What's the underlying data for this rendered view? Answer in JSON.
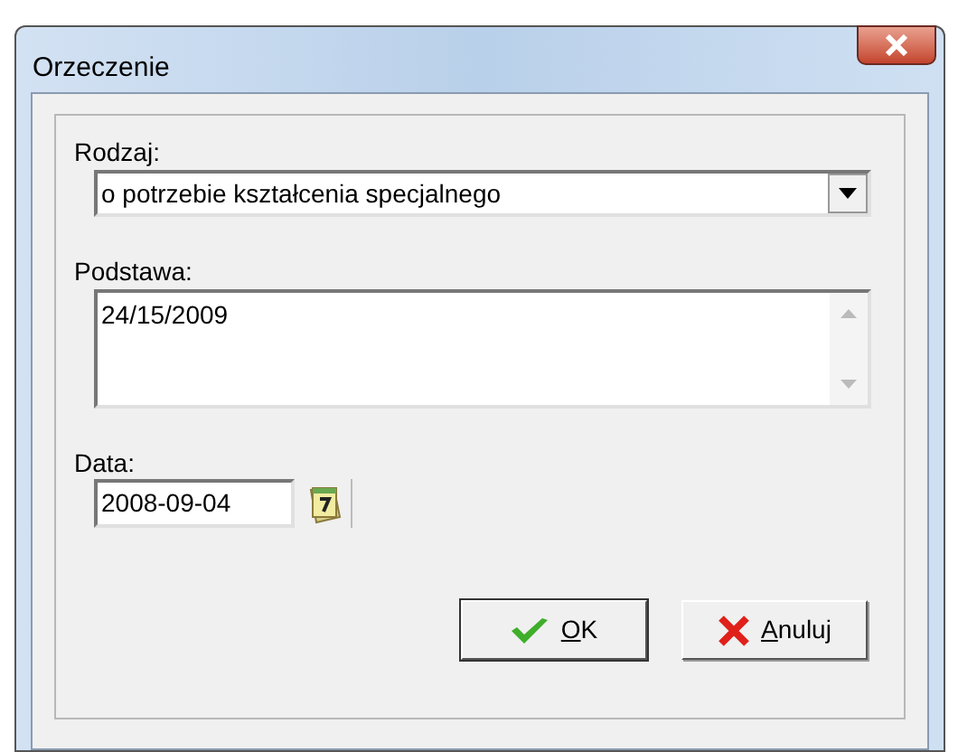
{
  "window": {
    "title": "Orzeczenie"
  },
  "fields": [
    {
      "kind": "dropdown",
      "label": "Rodzaj:",
      "value": "o potrzebie kształcenia specjalnego"
    },
    {
      "kind": "memo",
      "label": "Podstawa:",
      "value": "24/15/2009"
    },
    {
      "kind": "date",
      "label": "Data:",
      "value": "2008-09-04"
    }
  ],
  "buttons": [
    {
      "kind": "ok",
      "label": "OK"
    },
    {
      "kind": "cancel",
      "label": "Anuluj"
    }
  ]
}
